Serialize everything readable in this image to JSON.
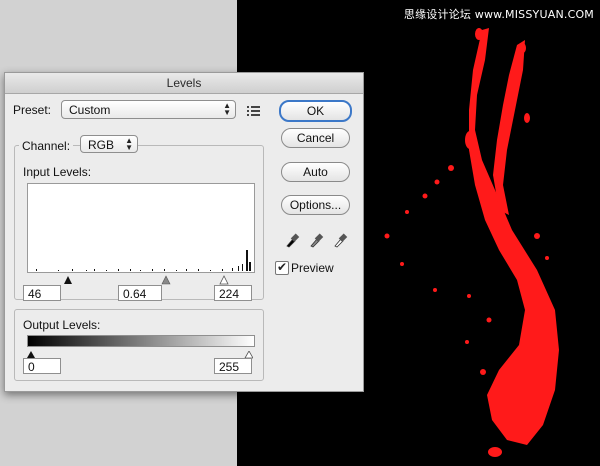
{
  "watermark": "思缘设计论坛 www.MISSYUAN.COM",
  "dialog": {
    "title": "Levels",
    "preset": {
      "label": "Preset:",
      "value": "Custom"
    },
    "channel": {
      "label": "Channel:",
      "value": "RGB"
    },
    "input_levels": {
      "label": "Input Levels:",
      "black": "46",
      "gamma": "0.64",
      "white": "224"
    },
    "output_levels": {
      "label": "Output Levels:",
      "black": "0",
      "white": "255"
    },
    "buttons": {
      "ok": "OK",
      "cancel": "Cancel",
      "auto": "Auto",
      "options": "Options..."
    },
    "preview": {
      "label": "Preview",
      "checked": true
    },
    "eyedroppers": [
      "black-point-eyedropper-icon",
      "gray-point-eyedropper-icon",
      "white-point-eyedropper-icon"
    ]
  },
  "colors": {
    "splash": "#ff1a1a",
    "canvas": "#000000",
    "dialog_bg": "#ececec"
  }
}
